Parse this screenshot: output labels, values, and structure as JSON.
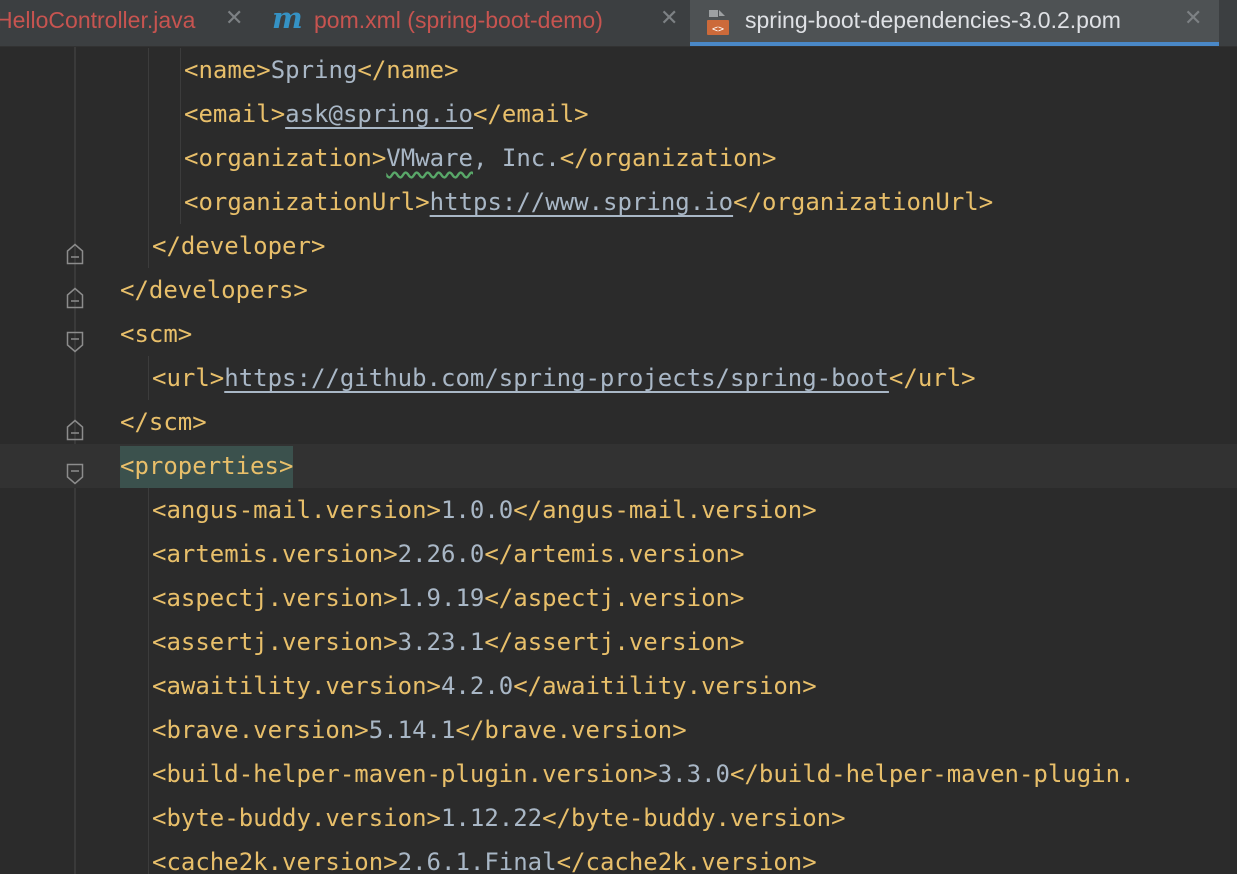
{
  "tabs": [
    {
      "label": "HelloController.java",
      "color": "#c75450",
      "active": false
    },
    {
      "label": "pom.xml (spring-boot-demo)",
      "color": "#c75450",
      "icon": "maven-m-icon",
      "active": false
    },
    {
      "label": "spring-boot-dependencies-3.0.2.pom",
      "color": "#dfe1e5",
      "icon": "pom-file-icon",
      "active": true
    }
  ],
  "close_glyph": "✕",
  "lines": [
    {
      "indent": 2,
      "fold": null,
      "parts": [
        [
          "t",
          "<name>"
        ],
        [
          "x",
          "Spring"
        ],
        [
          "t",
          "</name>"
        ]
      ]
    },
    {
      "indent": 2,
      "fold": null,
      "parts": [
        [
          "t",
          "<email>"
        ],
        [
          "l",
          "ask@spring.io"
        ],
        [
          "t",
          "</email>"
        ]
      ]
    },
    {
      "indent": 2,
      "fold": null,
      "parts": [
        [
          "t",
          "<organization>"
        ],
        [
          "w",
          "VMware"
        ],
        [
          "x",
          ", Inc."
        ],
        [
          "t",
          "</organization>"
        ]
      ]
    },
    {
      "indent": 2,
      "fold": null,
      "parts": [
        [
          "t",
          "<organizationUrl>"
        ],
        [
          "l",
          "https://www.spring.io"
        ],
        [
          "t",
          "</organizationUrl>"
        ]
      ]
    },
    {
      "indent": 1,
      "fold": "end",
      "parts": [
        [
          "t",
          "</developer>"
        ]
      ]
    },
    {
      "indent": 0,
      "fold": "end",
      "parts": [
        [
          "t",
          "</developers>"
        ]
      ]
    },
    {
      "indent": 0,
      "fold": "start",
      "parts": [
        [
          "t",
          "<scm>"
        ]
      ]
    },
    {
      "indent": 1,
      "fold": null,
      "parts": [
        [
          "t",
          "<url>"
        ],
        [
          "l",
          "https://github.com/spring-projects/spring-boot"
        ],
        [
          "t",
          "</url>"
        ]
      ]
    },
    {
      "indent": 0,
      "fold": "end",
      "parts": [
        [
          "t",
          "</scm>"
        ]
      ]
    },
    {
      "indent": 0,
      "fold": "start",
      "current": true,
      "parts": [
        [
          "m",
          "<properties>"
        ]
      ]
    },
    {
      "indent": 1,
      "fold": null,
      "parts": [
        [
          "t",
          "<angus-mail.version>"
        ],
        [
          "x",
          "1.0.0"
        ],
        [
          "t",
          "</angus-mail.version>"
        ]
      ]
    },
    {
      "indent": 1,
      "fold": null,
      "parts": [
        [
          "t",
          "<artemis.version>"
        ],
        [
          "x",
          "2.26.0"
        ],
        [
          "t",
          "</artemis.version>"
        ]
      ]
    },
    {
      "indent": 1,
      "fold": null,
      "parts": [
        [
          "t",
          "<aspectj.version>"
        ],
        [
          "x",
          "1.9.19"
        ],
        [
          "t",
          "</aspectj.version>"
        ]
      ]
    },
    {
      "indent": 1,
      "fold": null,
      "parts": [
        [
          "t",
          "<assertj.version>"
        ],
        [
          "x",
          "3.23.1"
        ],
        [
          "t",
          "</assertj.version>"
        ]
      ]
    },
    {
      "indent": 1,
      "fold": null,
      "parts": [
        [
          "t",
          "<awaitility.version>"
        ],
        [
          "x",
          "4.2.0"
        ],
        [
          "t",
          "</awaitility.version>"
        ]
      ]
    },
    {
      "indent": 1,
      "fold": null,
      "parts": [
        [
          "t",
          "<brave.version>"
        ],
        [
          "x",
          "5.14.1"
        ],
        [
          "t",
          "</brave.version>"
        ]
      ]
    },
    {
      "indent": 1,
      "fold": null,
      "parts": [
        [
          "t",
          "<build-helper-maven-plugin.version>"
        ],
        [
          "x",
          "3.3.0"
        ],
        [
          "t",
          "</build-helper-maven-plugin."
        ]
      ]
    },
    {
      "indent": 1,
      "fold": null,
      "parts": [
        [
          "t",
          "<byte-buddy.version>"
        ],
        [
          "x",
          "1.12.22"
        ],
        [
          "t",
          "</byte-buddy.version>"
        ]
      ]
    },
    {
      "indent": 1,
      "fold": null,
      "parts": [
        [
          "t",
          "<cache2k.version>"
        ],
        [
          "x",
          "2.6.1.Final"
        ],
        [
          "t",
          "</cache2k.version>"
        ]
      ]
    }
  ]
}
